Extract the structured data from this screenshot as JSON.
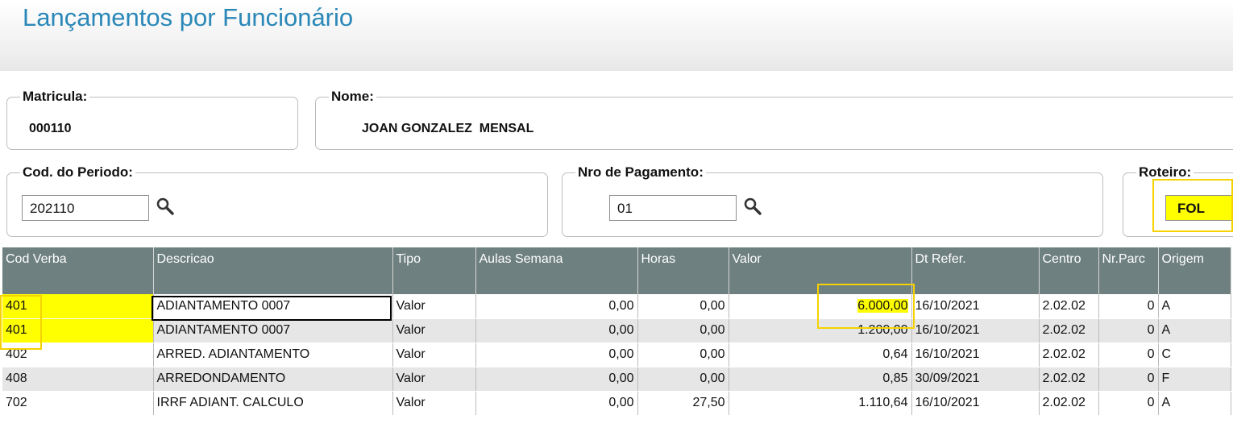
{
  "page": {
    "title": "Lançamentos por Funcionário"
  },
  "matricula": {
    "label": "Matricula:",
    "value": "000110"
  },
  "nome": {
    "label": "Nome:",
    "value": "JOAN GONZALEZ  MENSAL"
  },
  "periodo": {
    "label": "Cod. do Periodo:",
    "value": "202110",
    "icon": "search-icon"
  },
  "pagamento": {
    "label": "Nro de Pagamento:",
    "value": "01",
    "icon": "search-icon"
  },
  "roteiro": {
    "label": "Roteiro:",
    "value": "FOL"
  },
  "highlight_color": "#ffff00",
  "header_color": "#6f8080",
  "grid": {
    "columns": [
      "Cod Verba",
      "Descricao",
      "Tipo",
      "Aulas Semana",
      "Horas",
      "Valor",
      "Dt Refer.",
      "Centro",
      "Nr.Parc",
      "Origem"
    ],
    "rows": [
      [
        "401",
        "ADIANTAMENTO 0007",
        "Valor",
        "0,00",
        "0,00",
        "6.000,00",
        "16/10/2021",
        "2.02.02",
        "0",
        "A"
      ],
      [
        "401",
        "ADIANTAMENTO 0007",
        "Valor",
        "0,00",
        "0,00",
        "1.200,00",
        "16/10/2021",
        "2.02.02",
        "0",
        "A"
      ],
      [
        "402",
        "ARRED. ADIANTAMENTO",
        "Valor",
        "0,00",
        "0,00",
        "0,64",
        "16/10/2021",
        "2.02.02",
        "0",
        "C"
      ],
      [
        "408",
        "ARREDONDAMENTO",
        "Valor",
        "0,00",
        "0,00",
        "0,85",
        "30/09/2021",
        "2.02.02",
        "0",
        "F"
      ],
      [
        "702",
        "IRRF ADIANT. CALCULO",
        "Valor",
        "0,00",
        "27,50",
        "1.110,64",
        "16/10/2021",
        "2.02.02",
        "0",
        "A"
      ]
    ]
  }
}
